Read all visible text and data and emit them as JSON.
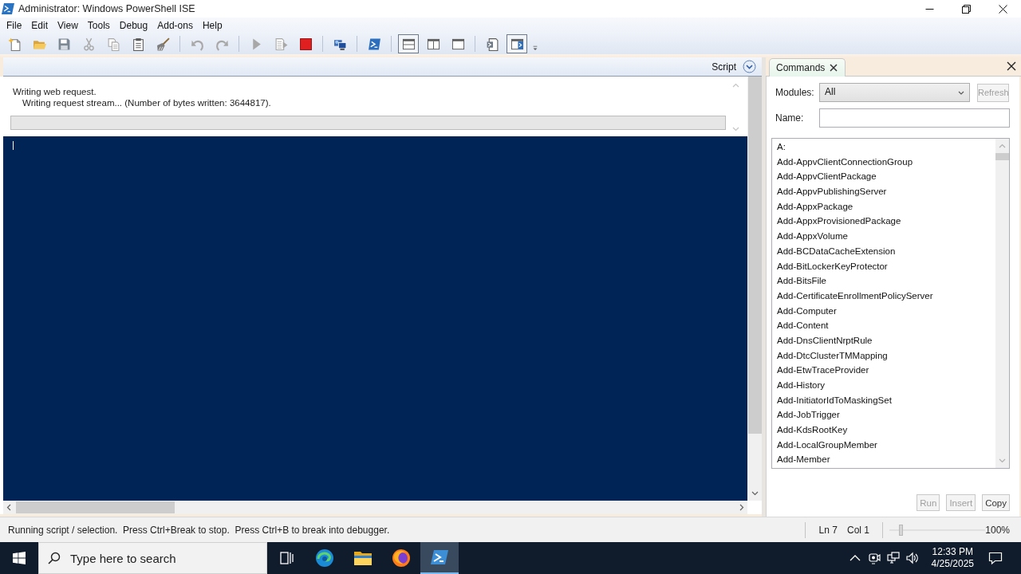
{
  "window": {
    "title": "Administrator: Windows PowerShell ISE"
  },
  "menu": [
    "File",
    "Edit",
    "View",
    "Tools",
    "Debug",
    "Add-ons",
    "Help"
  ],
  "toolbar": [
    [
      {
        "kind": "new",
        "disabled": false,
        "on": false
      },
      {
        "kind": "open",
        "disabled": false,
        "on": false
      },
      {
        "kind": "save",
        "disabled": false,
        "on": false
      },
      {
        "kind": "cut",
        "disabled": true,
        "on": false
      },
      {
        "kind": "copy",
        "disabled": true,
        "on": false
      },
      {
        "kind": "paste",
        "disabled": false,
        "on": false
      },
      {
        "kind": "clear",
        "disabled": false,
        "on": false
      }
    ],
    [
      {
        "kind": "undo",
        "disabled": true,
        "on": false
      },
      {
        "kind": "redo",
        "disabled": true,
        "on": false
      }
    ],
    [
      {
        "kind": "run",
        "disabled": true,
        "on": false
      },
      {
        "kind": "runsel",
        "disabled": true,
        "on": false
      },
      {
        "kind": "stop",
        "disabled": false,
        "on": false
      }
    ],
    [
      {
        "kind": "remote",
        "disabled": false,
        "on": false
      }
    ],
    [
      {
        "kind": "console",
        "disabled": false,
        "on": false
      }
    ],
    [
      {
        "kind": "layout_top",
        "disabled": false,
        "on": true
      },
      {
        "kind": "layout_right",
        "disabled": false,
        "on": false
      },
      {
        "kind": "layout_max",
        "disabled": false,
        "on": false
      }
    ],
    [
      {
        "kind": "cmdwin",
        "disabled": false,
        "on": false
      },
      {
        "kind": "addon",
        "disabled": false,
        "on": true
      },
      {
        "kind": "overflow",
        "disabled": false,
        "on": false
      }
    ]
  ],
  "script_pane": {
    "tab": "Script",
    "progress": {
      "activity": "Writing web request.",
      "status": "Writing request stream... (Number of bytes written: 3644817).",
      "level": 0
    }
  },
  "commands_panel": {
    "tab": "Commands",
    "modules_label": "Modules:",
    "modules_value": "All",
    "refresh": {
      "label": "Refresh",
      "disabled": true
    },
    "name_label": "Name:",
    "commands": [
      "A:",
      "Add-AppvClientConnectionGroup",
      "Add-AppvClientPackage",
      "Add-AppvPublishingServer",
      "Add-AppxPackage",
      "Add-AppxProvisionedPackage",
      "Add-AppxVolume",
      "Add-BCDataCacheExtension",
      "Add-BitLockerKeyProtector",
      "Add-BitsFile",
      "Add-CertificateEnrollmentPolicyServer",
      "Add-Computer",
      "Add-Content",
      "Add-DnsClientNrptRule",
      "Add-DtcClusterTMMapping",
      "Add-EtwTraceProvider",
      "Add-History",
      "Add-InitiatorIdToMaskingSet",
      "Add-JobTrigger",
      "Add-KdsRootKey",
      "Add-LocalGroupMember",
      "Add-Member"
    ],
    "buttons": [
      {
        "label": "Run",
        "disabled": true
      },
      {
        "label": "Insert",
        "disabled": true
      },
      {
        "label": "Copy",
        "disabled": false
      }
    ]
  },
  "status_bar": {
    "message": "Running script / selection.  Press Ctrl+Break to stop.  Press Ctrl+B to break into debugger.",
    "line": "Ln 7",
    "column": "Col 1",
    "zoom_slider": {
      "level": 0.1
    },
    "zoom": "100%"
  },
  "taskbar": {
    "search_placeholder": "Type here to search",
    "apps": [
      {
        "kind": "edge",
        "selected": false
      },
      {
        "kind": "explorer",
        "selected": false
      },
      {
        "kind": "firefox",
        "selected": false
      },
      {
        "kind": "powershell",
        "selected": true
      }
    ],
    "time": "12:33 PM",
    "date": "4/25/2025"
  }
}
